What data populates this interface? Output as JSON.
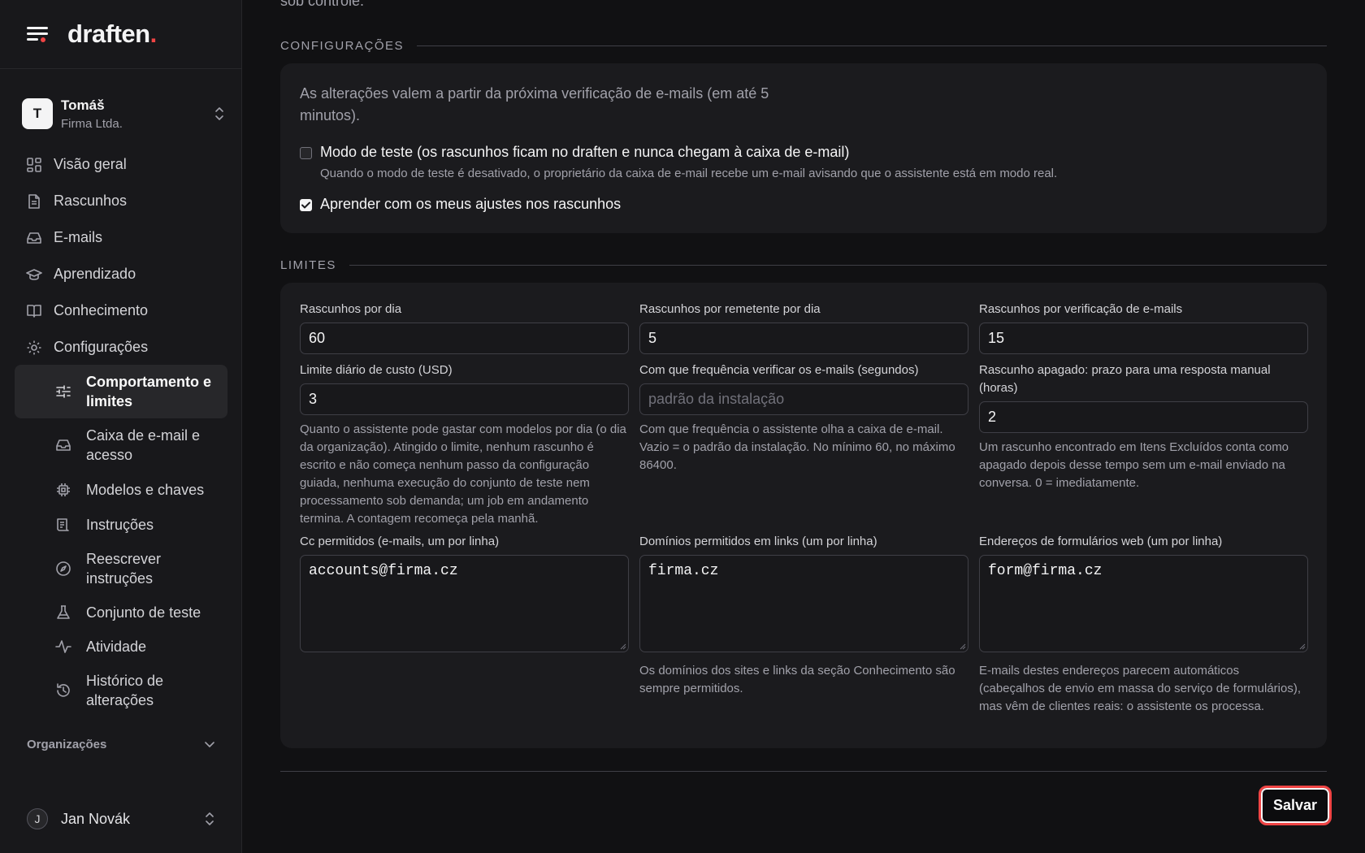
{
  "brand": {
    "name": "draften",
    "dot": "."
  },
  "org": {
    "initial": "T",
    "name": "Tomáš",
    "company": "Firma Ltda."
  },
  "nav": [
    {
      "label": "Visão geral",
      "icon": "dashboard-icon"
    },
    {
      "label": "Rascunhos",
      "icon": "document-icon"
    },
    {
      "label": "E-mails",
      "icon": "inbox-icon"
    },
    {
      "label": "Aprendizado",
      "icon": "graduation-cap-icon"
    },
    {
      "label": "Conhecimento",
      "icon": "book-icon"
    },
    {
      "label": "Configurações",
      "icon": "gear-icon"
    }
  ],
  "subnav": [
    {
      "label": "Comportamento e limites",
      "icon": "sliders-icon",
      "active": true
    },
    {
      "label": "Caixa de e-mail e acesso",
      "icon": "inbox-icon"
    },
    {
      "label": "Modelos e chaves",
      "icon": "chip-icon"
    },
    {
      "label": "Instruções",
      "icon": "scroll-icon"
    },
    {
      "label": "Reescrever instruções",
      "icon": "compass-icon"
    },
    {
      "label": "Conjunto de teste",
      "icon": "flask-icon"
    },
    {
      "label": "Atividade",
      "icon": "activity-icon"
    },
    {
      "label": "Histórico de alterações",
      "icon": "history-icon"
    }
  ],
  "organizations_label": "Organizações",
  "user": {
    "initial": "J",
    "name": "Jan Novák"
  },
  "top_cut_text": "sob controle.",
  "config": {
    "heading": "CONFIGURAÇÕES",
    "note": "As alterações valem a partir da próxima verificação de e-mails (em até 5 minutos).",
    "test_mode": {
      "label": "Modo de teste (os rascunhos ficam no draften e nunca chegam à caixa de e-mail)",
      "help": "Quando o modo de teste é desativado, o proprietário da caixa de e-mail recebe um e-mail avisando que o assistente está em modo real.",
      "checked": false
    },
    "learn": {
      "label": "Aprender com os meus ajustes nos rascunhos",
      "checked": true
    }
  },
  "limits": {
    "heading": "LIMITES",
    "drafts_per_day": {
      "label": "Rascunhos por dia",
      "value": "60"
    },
    "drafts_per_sender": {
      "label": "Rascunhos por remetente por dia",
      "value": "5"
    },
    "drafts_per_check": {
      "label": "Rascunhos por verificação de e-mails",
      "value": "15"
    },
    "daily_cost": {
      "label": "Limite diário de custo (USD)",
      "value": "3",
      "help": "Quanto o assistente pode gastar com modelos por dia (o dia da organização). Atingido o limite, nenhum rascunho é escrito e não começa nenhum passo da configuração guiada, nenhuma execução do conjunto de teste nem processamento sob demanda; um job em andamento termina. A contagem recomeça pela manhã."
    },
    "check_frequency": {
      "label": "Com que frequência verificar os e-mails (segundos)",
      "placeholder": "padrão da instalação",
      "help": "Com que frequência o assistente olha a caixa de e-mail. Vazio = o padrão da instalação. No mínimo 60, no máximo 86400."
    },
    "deleted_draft": {
      "label": "Rascunho apagado: prazo para uma resposta manual (horas)",
      "value": "2",
      "help": "Um rascunho encontrado em Itens Excluídos conta como apagado depois desse tempo sem um e-mail enviado na conversa. 0 = imediatamente."
    },
    "cc_allowed": {
      "label": "Cc permitidos (e-mails, um por linha)",
      "value": "accounts@firma.cz"
    },
    "link_domains": {
      "label": "Domínios permitidos em links (um por linha)",
      "value": "firma.cz",
      "help": "Os domínios dos sites e links da seção Conhecimento são sempre permitidos."
    },
    "web_forms": {
      "label": "Endereços de formulários web (um por linha)",
      "value": "form@firma.cz",
      "help": "E-mails destes endereços parecem automáticos (cabeçalhos de envio em massa do serviço de formulários), mas vêm de clientes reais: o assistente os processa."
    }
  },
  "save_label": "Salvar",
  "colors": {
    "accent": "#ef4444",
    "bg": "#111113",
    "sidebar": "#18181b",
    "card": "#1b1b1e"
  }
}
